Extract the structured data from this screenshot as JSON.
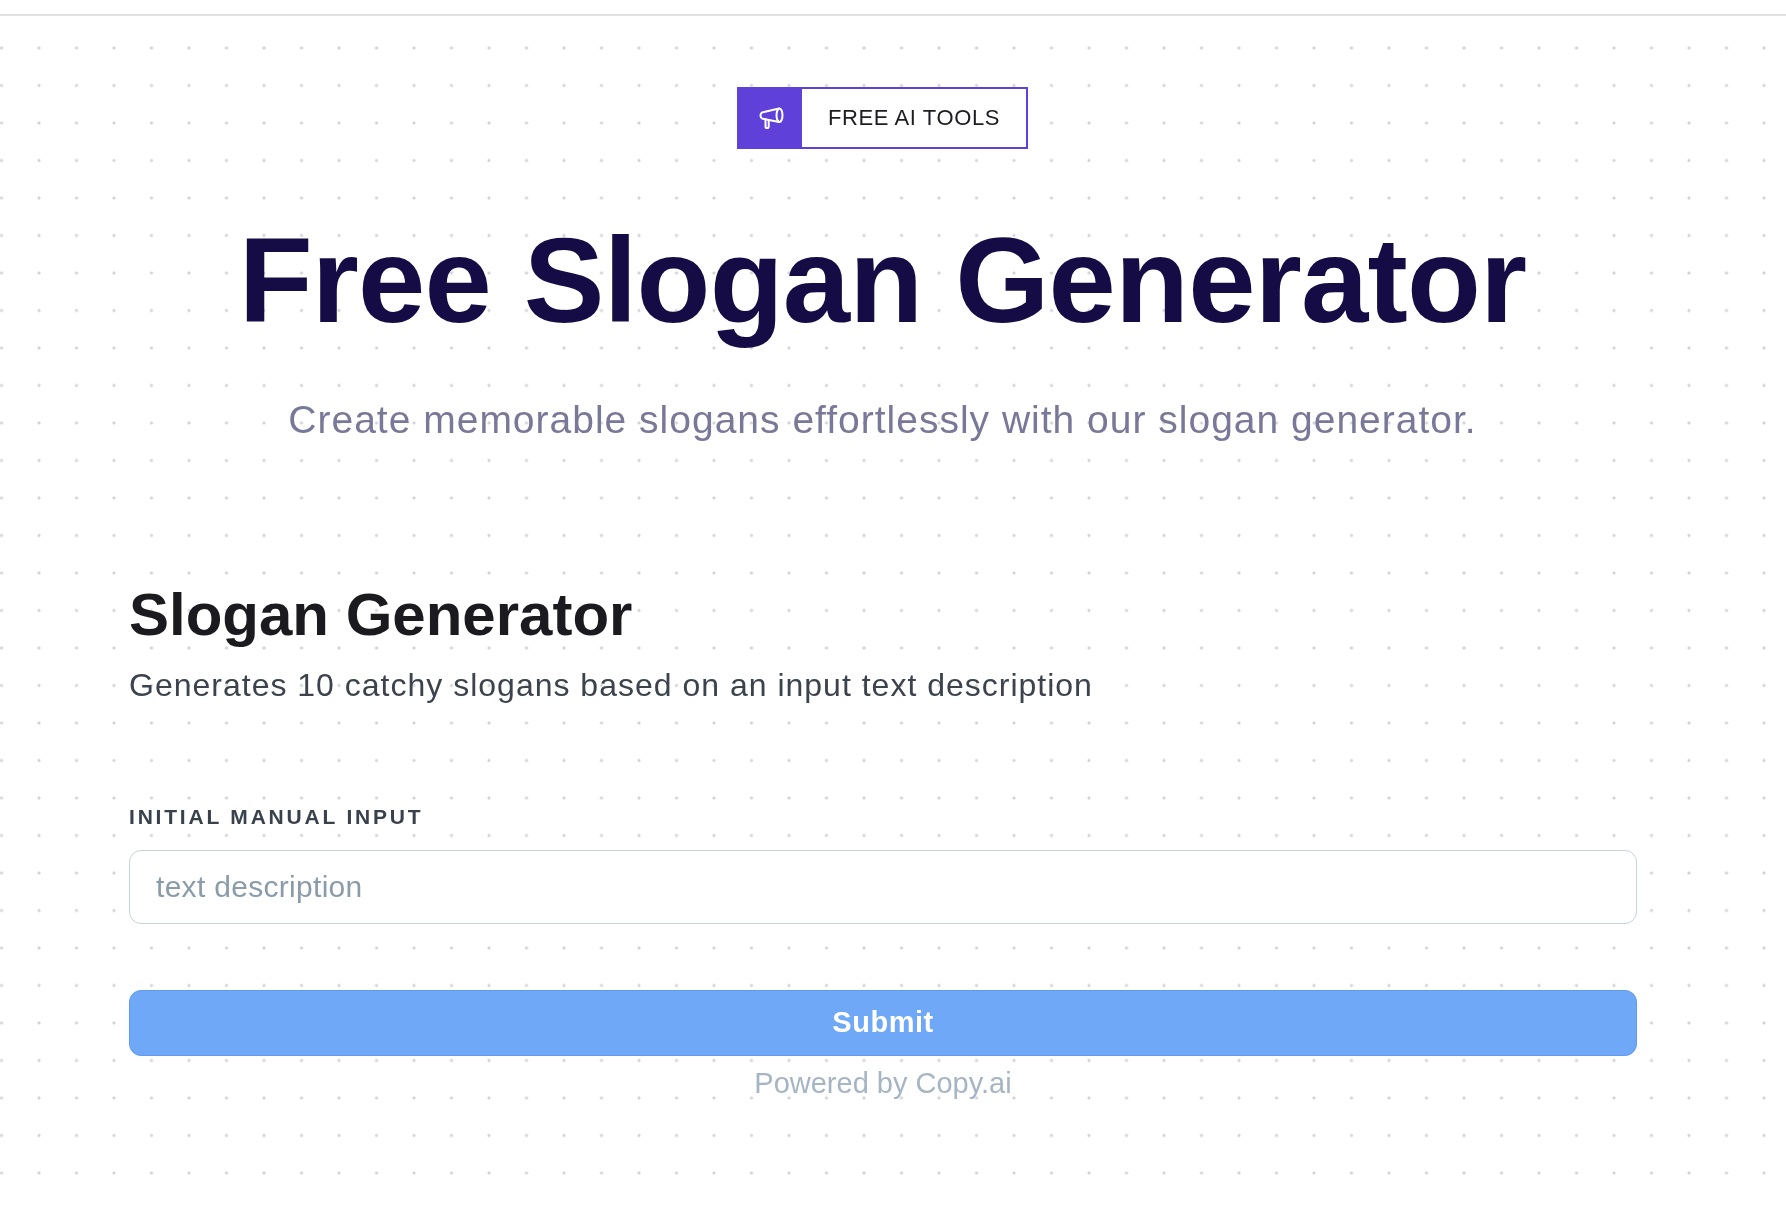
{
  "badge": {
    "label": "FREE AI TOOLS"
  },
  "hero": {
    "title": "Free Slogan Generator",
    "subtitle": "Create memorable slogans effortlessly with our slogan generator."
  },
  "tool": {
    "title": "Slogan Generator",
    "description": "Generates 10 catchy slogans based on an input text description"
  },
  "form": {
    "fields": [
      {
        "label": "INITIAL MANUAL INPUT",
        "placeholder": "text description"
      }
    ],
    "submit": {
      "label": "Submit"
    },
    "footer": "Powered by Copy.ai"
  }
}
